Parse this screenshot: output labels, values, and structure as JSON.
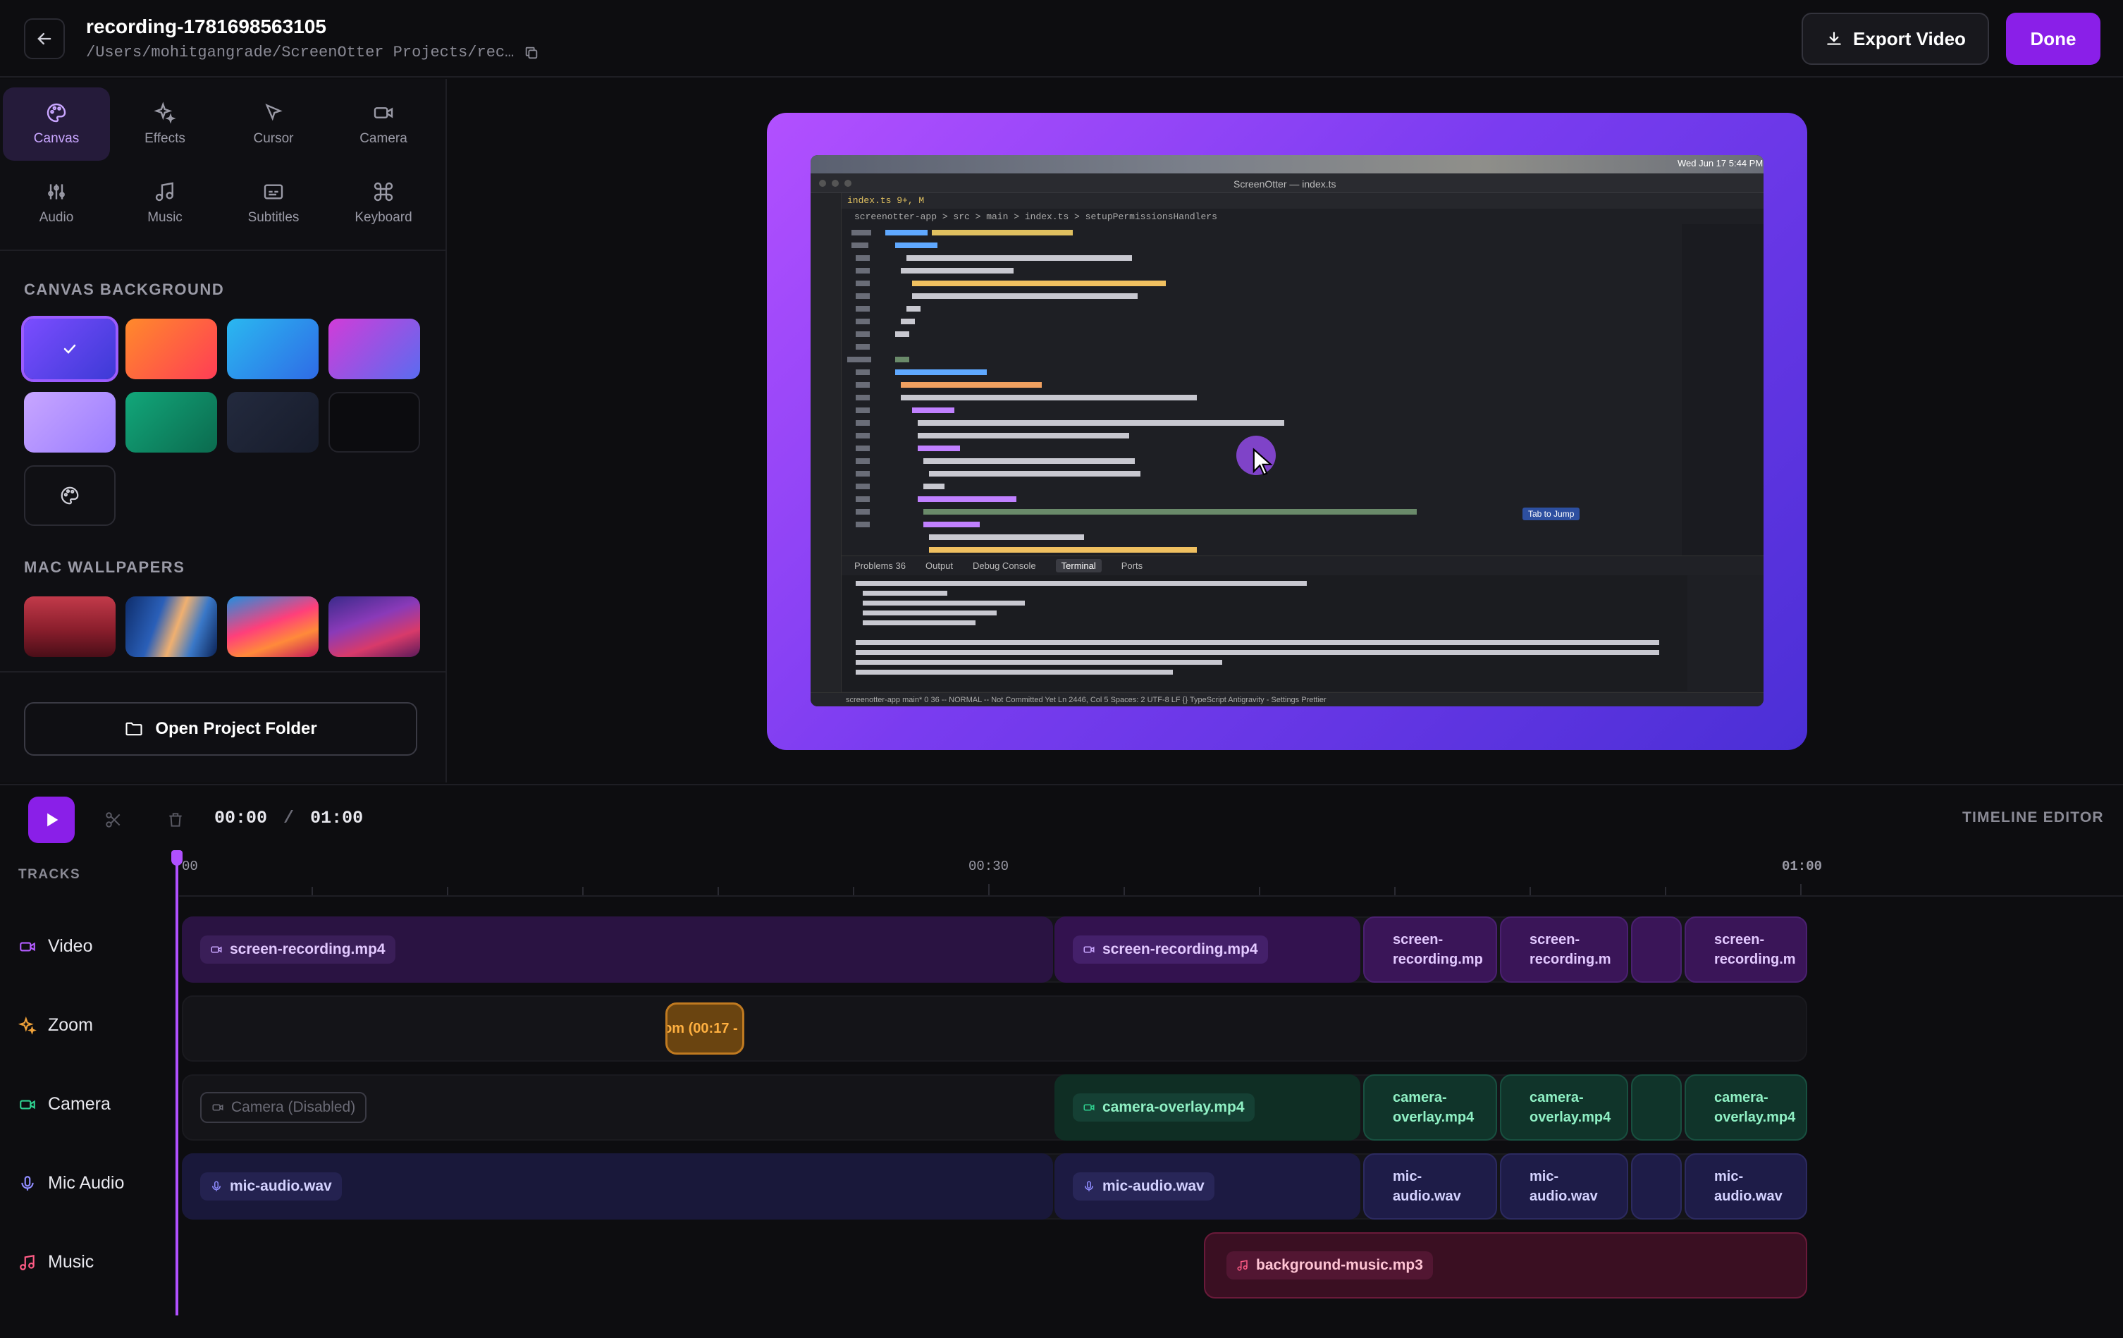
{
  "header": {
    "title": "recording-1781698563105",
    "path": "/Users/mohitgangrade/ScreenOtter Projects/rec…",
    "export_label": "Export Video",
    "done_label": "Done"
  },
  "tools": [
    {
      "label": "Canvas",
      "icon": "palette-icon"
    },
    {
      "label": "Effects",
      "icon": "sparkles-icon"
    },
    {
      "label": "Cursor",
      "icon": "cursor-icon"
    },
    {
      "label": "Camera",
      "icon": "camera-icon"
    },
    {
      "label": "Audio",
      "icon": "sliders-icon"
    },
    {
      "label": "Music",
      "icon": "music-note-icon"
    },
    {
      "label": "Subtitles",
      "icon": "subtitles-icon"
    },
    {
      "label": "Keyboard",
      "icon": "command-key-icon"
    }
  ],
  "canvas_background": {
    "heading": "CANVAS BACKGROUND",
    "selected_index": 0
  },
  "mac_wallpapers": {
    "heading": "MAC WALLPAPERS"
  },
  "open_folder_label": "Open Project Folder",
  "editor": {
    "window_title": "ScreenOtter — index.ts",
    "tab": "index.ts 9+, M",
    "breadcrumb": "screenotter-app > src > main > index.ts > setupPermissionsHandlers",
    "hint": "Tab to Jump",
    "panel_tabs": [
      "Problems 36",
      "Output",
      "Debug Console",
      "Terminal",
      "Ports"
    ],
    "status": "screenotter-app   main*   0  36   -- NORMAL --      Not Committed Yet   Ln 2446, Col 5   Spaces: 2   UTF-8   LF   {} TypeScript   Antigravity - Settings   Prettier",
    "menubar_date": "Wed Jun 17  5:44 PM"
  },
  "timeline": {
    "current_time": "00:00",
    "separator": "/",
    "total_time": "01:00",
    "label": "TIMELINE EDITOR",
    "tracks_heading": "TRACKS",
    "ruler": [
      "00",
      "00:30",
      "01:00"
    ],
    "tracks": [
      {
        "name": "Video",
        "icon": "video-icon",
        "color": "#b35cff"
      },
      {
        "name": "Zoom",
        "icon": "zoom-sparkle-icon",
        "color": "#f0a23a"
      },
      {
        "name": "Camera",
        "icon": "camera-icon",
        "color": "#2fd08f"
      },
      {
        "name": "Mic Audio",
        "icon": "mic-icon",
        "color": "#8f8cff"
      },
      {
        "name": "Music",
        "icon": "music-note-icon",
        "color": "#ff5c86"
      }
    ],
    "clips": {
      "video_main": "screen-recording.mp4",
      "video_2": "screen-recording.mp4",
      "video_3": "screen-recording.mp",
      "video_4": "screen-recording.m",
      "video_6": "screen-recording.m",
      "zoom": "om (00:17 - (",
      "camera_disabled": "Camera (Disabled)",
      "camera_2": "camera-overlay.mp4",
      "camera_3": "camera-overlay.mp4",
      "camera_4": "camera-overlay.mp4",
      "camera_6": "camera-overlay.mp4",
      "mic_main": "mic-audio.wav",
      "mic_2": "mic-audio.wav",
      "mic_3": "mic-audio.wav",
      "mic_4": "mic-audio.wav",
      "mic_6": "mic-audio.wav",
      "music": "background-music.mp3"
    }
  }
}
